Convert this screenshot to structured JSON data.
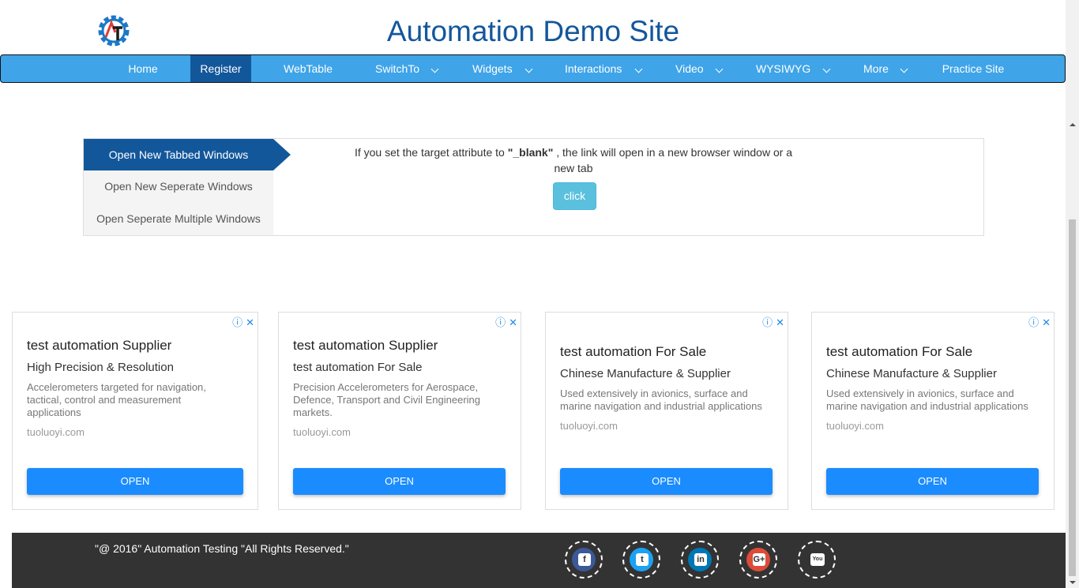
{
  "header": {
    "title": "Automation Demo Site",
    "logo_icon": "automation-gear-logo"
  },
  "nav": {
    "items": [
      {
        "label": "Home",
        "dropdown": false
      },
      {
        "label": "Register",
        "dropdown": false,
        "active": true
      },
      {
        "label": "WebTable",
        "dropdown": false
      },
      {
        "label": "SwitchTo",
        "dropdown": true
      },
      {
        "label": "Widgets",
        "dropdown": true
      },
      {
        "label": "Interactions",
        "dropdown": true
      },
      {
        "label": "Video",
        "dropdown": true
      },
      {
        "label": "WYSIWYG",
        "dropdown": true
      },
      {
        "label": "More",
        "dropdown": true
      },
      {
        "label": "Practice Site",
        "dropdown": false
      }
    ]
  },
  "windows": {
    "tabs": [
      {
        "label": "Open New Tabbed Windows"
      },
      {
        "label": "Open New Seperate Windows"
      },
      {
        "label": "Open Seperate Multiple Windows"
      }
    ],
    "text_before": "If you set the target attribute to ",
    "text_strong": "\"_blank\"",
    "text_after": " , the link will open in a new browser window or a new tab",
    "button_label": "click"
  },
  "ads": [
    {
      "title": "test automation Supplier",
      "subtitle": "High Precision & Resolution",
      "description": "Accelerometers targeted for navigation, tactical, control and measurement applications",
      "url": "tuoluoyi.com",
      "button": "OPEN",
      "info_icon": "ⓘ",
      "close_icon": "✕"
    },
    {
      "title": "test automation Supplier",
      "subtitle": "test automation For Sale",
      "description": "Precision Accelerometers for Aerospace, Defence, Transport and Civil Engineering markets.",
      "url": "tuoluoyi.com",
      "button": "OPEN",
      "info_icon": "ⓘ",
      "close_icon": "✕"
    },
    {
      "title": "test automation For Sale",
      "subtitle": "Chinese Manufacture & Supplier",
      "description": "Used extensively in avionics, surface and marine navigation and industrial applications",
      "url": "tuoluoyi.com",
      "button": "OPEN",
      "info_icon": "ⓘ",
      "close_icon": "✕"
    },
    {
      "title": "test automation For Sale",
      "subtitle": "Chinese Manufacture & Supplier",
      "description": "Used extensively in avionics, surface and marine navigation and industrial applications",
      "url": "tuoluoyi.com",
      "button": "OPEN",
      "info_icon": "ⓘ",
      "close_icon": "✕"
    }
  ],
  "footer": {
    "copyright": "\"@ 2016\" Automation Testing \"All Rights Reserved.\"",
    "social": [
      {
        "name": "facebook",
        "color": "#3b5998",
        "glyph": "f"
      },
      {
        "name": "twitter",
        "color": "#1da1f2",
        "glyph": "t"
      },
      {
        "name": "linkedin",
        "color": "#0077b5",
        "glyph": "in"
      },
      {
        "name": "google-plus",
        "color": "#dd4b39",
        "glyph": "G+"
      },
      {
        "name": "youtube",
        "color": "#333333",
        "glyph": "You"
      }
    ]
  },
  "colors": {
    "brand_dark": "#13579b",
    "nav_blue": "#3fa4e8",
    "ad_button": "#1a8cff",
    "info_button": "#5bc0de"
  }
}
